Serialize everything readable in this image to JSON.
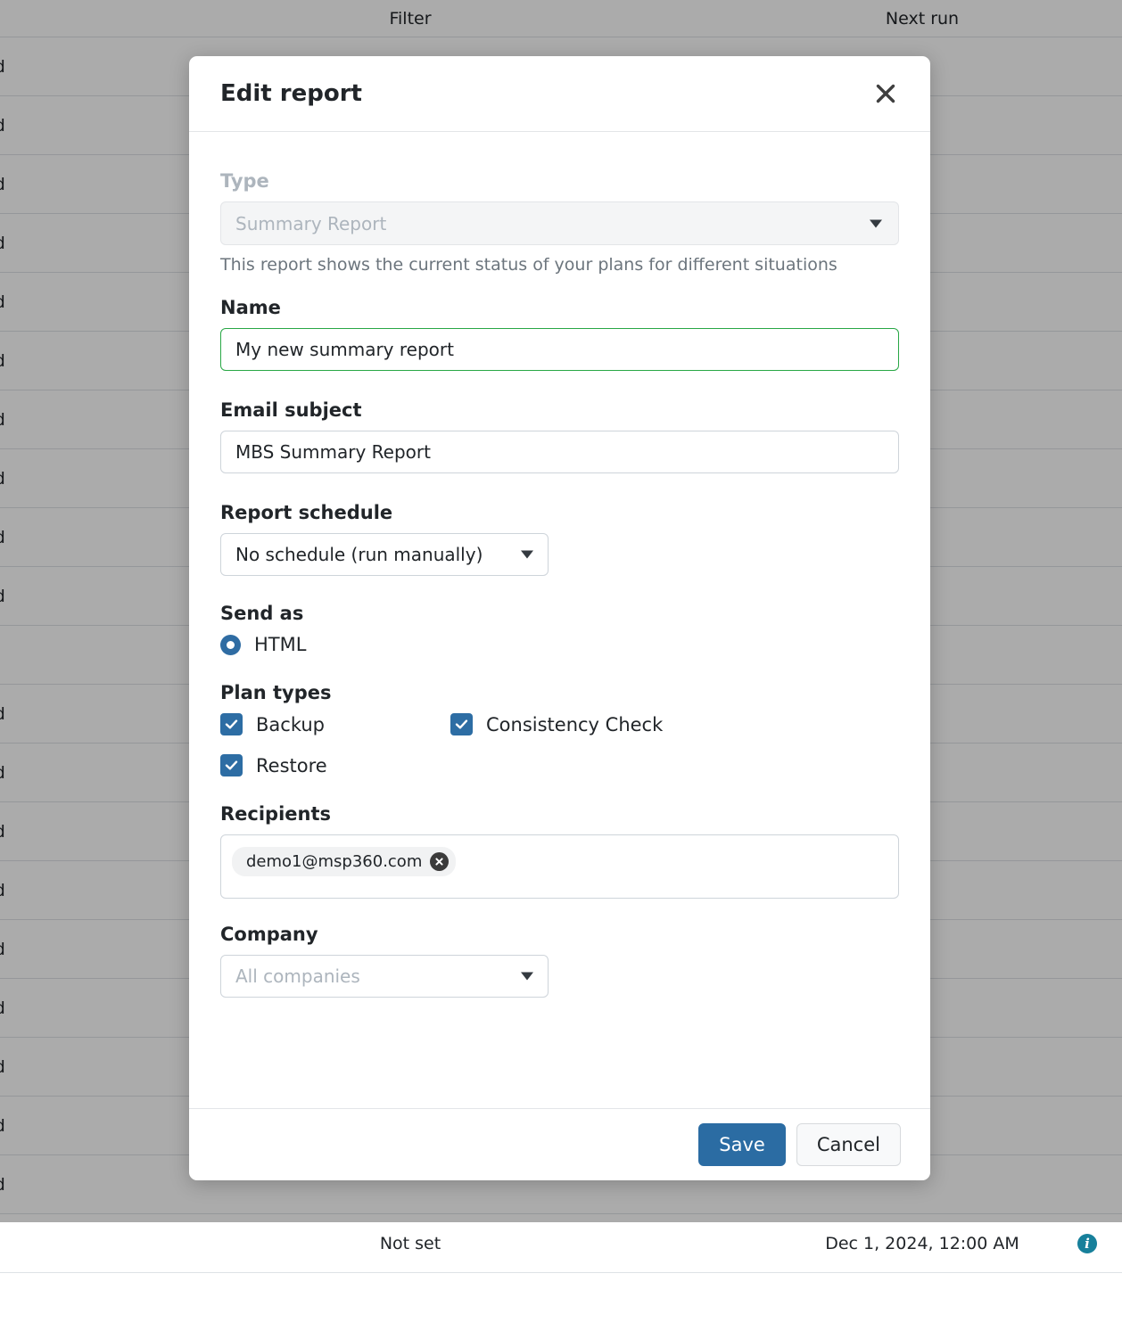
{
  "background": {
    "columns": {
      "filter": "Filter",
      "next_run": "Next run"
    },
    "rows": [
      {
        "status": "ed",
        "filter": "",
        "next_run": ""
      },
      {
        "status": "ed",
        "filter": "",
        "next_run": ""
      },
      {
        "status": "ed",
        "filter": "",
        "next_run": ""
      },
      {
        "status": "ed",
        "filter": "",
        "next_run": ""
      },
      {
        "status": "ed",
        "filter": "",
        "next_run": ""
      },
      {
        "status": "ed",
        "filter": "",
        "next_run": ""
      },
      {
        "status": "ed",
        "filter": "",
        "next_run": ""
      },
      {
        "status": "ed",
        "filter": "",
        "next_run": ""
      },
      {
        "status": "ed",
        "filter": "",
        "next_run": ""
      },
      {
        "status": "ed",
        "filter": "",
        "next_run": ""
      },
      {
        "status": "",
        "filter": "",
        "next_run": ""
      },
      {
        "status": "ed",
        "filter": "",
        "next_run": ""
      },
      {
        "status": "ed",
        "filter": "",
        "next_run": ""
      },
      {
        "status": "ed",
        "filter": "",
        "next_run": ""
      },
      {
        "status": "ed",
        "filter": "",
        "next_run": ""
      },
      {
        "status": "ed",
        "filter": "",
        "next_run": ""
      },
      {
        "status": "ed",
        "filter": "",
        "next_run": ""
      },
      {
        "status": "ed",
        "filter": "",
        "next_run": ""
      },
      {
        "status": "ed",
        "filter": "",
        "next_run": ""
      },
      {
        "status": "ed",
        "filter": "",
        "next_run": ""
      },
      {
        "status": "",
        "filter": "Not set",
        "next_run": "Dec 1, 2024, 12:00 AM",
        "info": true
      },
      {
        "status": "",
        "filter": "",
        "next_run": ""
      }
    ]
  },
  "modal": {
    "title": "Edit report",
    "close_icon": "close-icon",
    "type": {
      "label": "Type",
      "value": "Summary Report",
      "help": "This report shows the current status of your plans for different situations"
    },
    "name": {
      "label": "Name",
      "value": "My new summary report",
      "placeholder": "Name"
    },
    "email_subject": {
      "label": "Email subject",
      "value": "MBS Summary Report",
      "placeholder": "Email subject"
    },
    "schedule": {
      "label": "Report schedule",
      "value": "No schedule (run manually)"
    },
    "send_as": {
      "label": "Send as",
      "options": [
        {
          "label": "HTML",
          "selected": true
        }
      ]
    },
    "plan_types": {
      "label": "Plan types",
      "items": [
        {
          "label": "Backup",
          "checked": true
        },
        {
          "label": "Consistency Check",
          "checked": true
        },
        {
          "label": "Restore",
          "checked": true
        }
      ]
    },
    "recipients": {
      "label": "Recipients",
      "chips": [
        {
          "email": "demo1@msp360.com"
        }
      ]
    },
    "company": {
      "label": "Company",
      "placeholder": "All companies",
      "value": ""
    },
    "footer": {
      "save_label": "Save",
      "cancel_label": "Cancel"
    }
  },
  "colors": {
    "primary": "#2b6ca3",
    "checkbox": "#2d6da4",
    "focus_border": "#28a745",
    "info": "#17809b"
  }
}
